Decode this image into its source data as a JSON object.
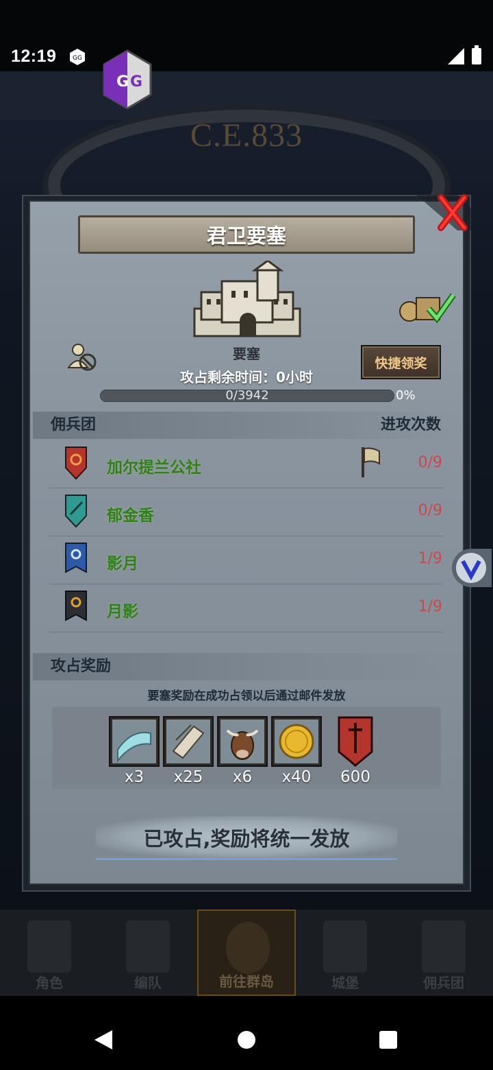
{
  "status_bar": {
    "time": "12:19"
  },
  "background": {
    "era_label": "C.E.833"
  },
  "dialog": {
    "title": "君卫要塞",
    "fortress_label": "要塞",
    "quick_claim_label": "快捷领奖",
    "remaining_time": "攻占剩余时间：0小时",
    "progress": {
      "text": "0/3942",
      "percent_text": "0%",
      "fraction": 0.0
    },
    "mercenary_header": "佣兵团",
    "attack_count_header": "进攻次数",
    "mercenaries": [
      {
        "name": "加尔提兰公社",
        "count": "0/9",
        "shield_color": "#b4352c",
        "has_flag": true
      },
      {
        "name": "郁金香",
        "count": "0/9",
        "shield_color": "#2e9a92",
        "has_flag": false
      },
      {
        "name": "影月",
        "count": "1/9",
        "shield_color": "#2a5aa8",
        "has_flag": false
      },
      {
        "name": "月影",
        "count": "1/9",
        "shield_color": "#2b2e33",
        "has_flag": false
      }
    ],
    "reward_header": "攻占奖励",
    "reward_note": "要塞奖励在成功占领以后通过邮件发放",
    "rewards": [
      {
        "icon": "cloth-icon",
        "qty": "x3"
      },
      {
        "icon": "scroll-icon",
        "qty": "x25"
      },
      {
        "icon": "bull-icon",
        "qty": "x6"
      },
      {
        "icon": "gold-coin-icon",
        "qty": "x40"
      },
      {
        "icon": "red-banner-icon",
        "qty": "600"
      }
    ],
    "status_button": "已攻占,奖励将统一发放"
  },
  "bottom_nav": [
    {
      "label": "角色",
      "active": false
    },
    {
      "label": "编队",
      "active": false
    },
    {
      "label": "前往群岛",
      "active": true
    },
    {
      "label": "城堡",
      "active": false
    },
    {
      "label": "佣兵团",
      "active": false
    }
  ],
  "colors": {
    "accent": "#f3c98a",
    "mercenary_name": "#2f7f1f",
    "attack_count": "#c84a4a"
  }
}
